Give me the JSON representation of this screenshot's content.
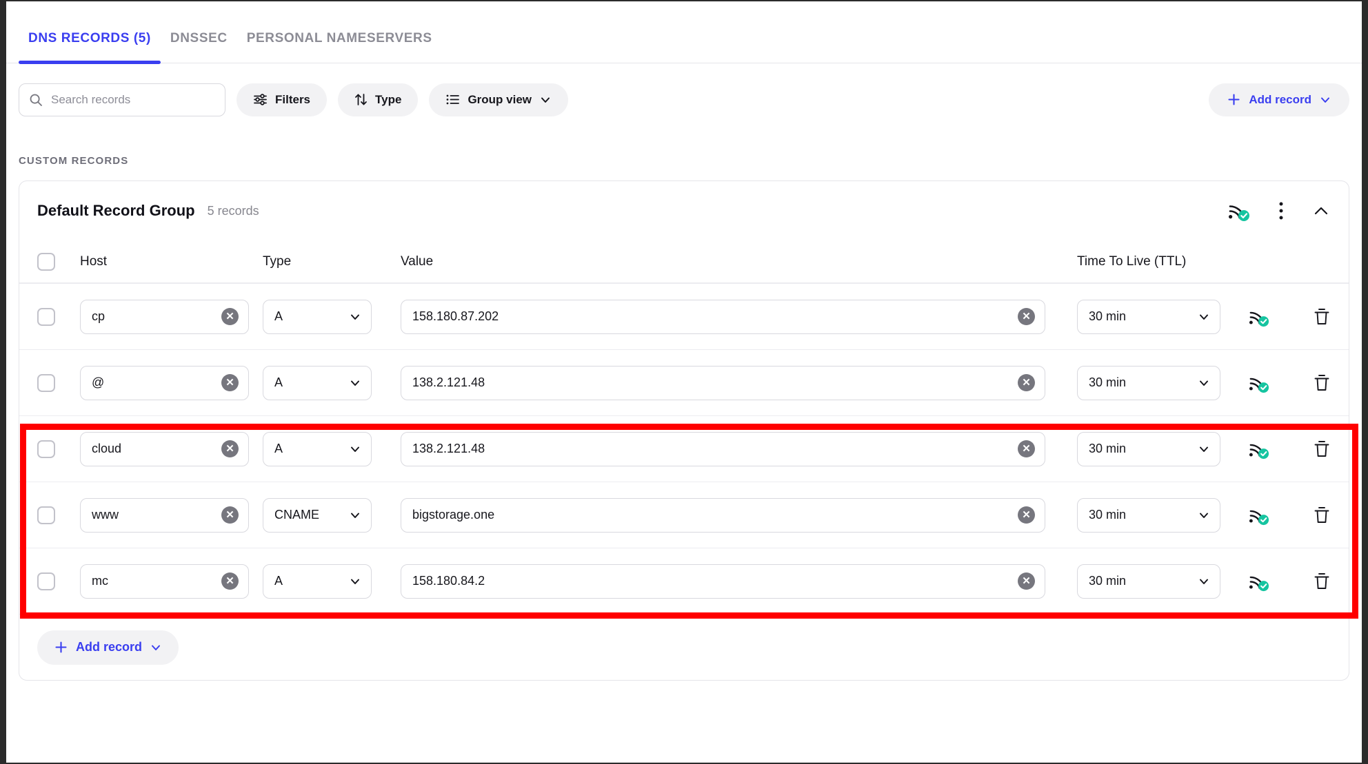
{
  "tabs": [
    {
      "label": "DNS RECORDS (5)",
      "active": true
    },
    {
      "label": "DNSSEC",
      "active": false
    },
    {
      "label": "PERSONAL NAMESERVERS",
      "active": false
    }
  ],
  "toolbar": {
    "search_placeholder": "Search records",
    "search_value": "",
    "filters_label": "Filters",
    "type_label": "Type",
    "group_view_label": "Group view",
    "add_record_label": "Add record"
  },
  "section": {
    "label": "CUSTOM RECORDS"
  },
  "group": {
    "title": "Default Record Group",
    "count": "5 records"
  },
  "columns": {
    "host": "Host",
    "type": "Type",
    "value": "Value",
    "ttl": "Time To Live (TTL)"
  },
  "records": [
    {
      "host": "cp",
      "type": "A",
      "value": "158.180.87.202",
      "ttl": "30 min",
      "highlighted": false
    },
    {
      "host": "@",
      "type": "A",
      "value": "138.2.121.48",
      "ttl": "30 min",
      "highlighted": true
    },
    {
      "host": "cloud",
      "type": "A",
      "value": "138.2.121.48",
      "ttl": "30 min",
      "highlighted": true
    },
    {
      "host": "www",
      "type": "CNAME",
      "value": "bigstorage.one",
      "ttl": "30 min",
      "highlighted": true
    },
    {
      "host": "mc",
      "type": "A",
      "value": "158.180.84.2",
      "ttl": "30 min",
      "highlighted": false
    }
  ],
  "footer": {
    "add_record_label": "Add record"
  },
  "colors": {
    "accent_blue": "#3a3ef0",
    "status_teal": "#16c4a0",
    "highlight_red": "#ff0000",
    "muted_text": "#8c8c95"
  }
}
